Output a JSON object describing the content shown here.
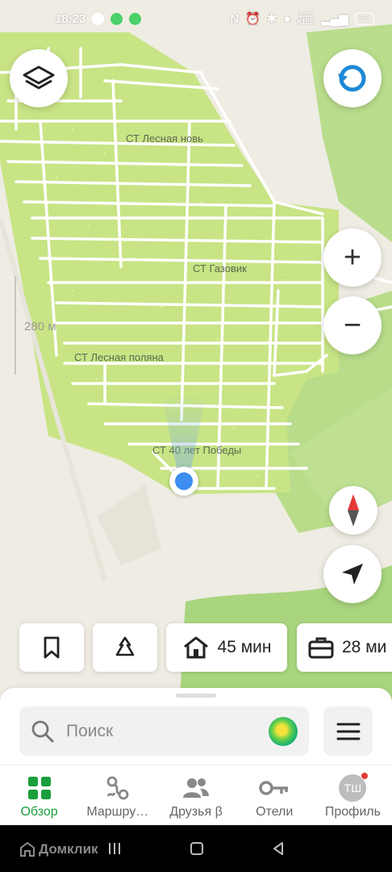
{
  "status": {
    "time": "18:23",
    "speed_value": "3,00",
    "speed_unit": "KB/S",
    "battery": "52"
  },
  "map": {
    "labels": [
      "СТ Лесная новь",
      "СТ Газовик",
      "СТ Лесная поляна",
      "СТ 40 лет Победы"
    ],
    "scale": "280 м",
    "colors": {
      "land": "#efece3",
      "green_area": "#c5e17e",
      "forest": "#b6dd8b",
      "road": "#ffffff",
      "location": "#3d8ef0"
    }
  },
  "buttons": {
    "layers": "layers-icon",
    "rotate": "rotate-icon",
    "zoom_in": "+",
    "zoom_out": "−",
    "compass": "compass-icon",
    "locate": "navigation-arrow-icon"
  },
  "chips": {
    "home_time": "45 мин",
    "work_time": "28 ми"
  },
  "search": {
    "placeholder": "Поиск"
  },
  "tabs": [
    {
      "label": "Обзор",
      "icon": "grid-icon",
      "active": true
    },
    {
      "label": "Маршру…",
      "icon": "route-icon",
      "active": false
    },
    {
      "label": "Друзья β",
      "icon": "friends-icon",
      "active": false
    },
    {
      "label": "Отели",
      "icon": "key-icon",
      "active": false
    },
    {
      "label": "Профиль",
      "icon": "avatar",
      "active": false,
      "initials": "ТШ"
    }
  ],
  "watermark": "Домклик",
  "accent_color": "#1a9f3c"
}
